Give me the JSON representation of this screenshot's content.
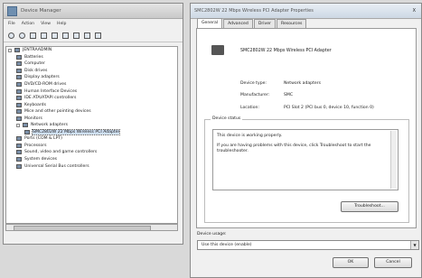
{
  "device_manager": {
    "title": "Device Manager",
    "menu": [
      "File",
      "Action",
      "View",
      "Help"
    ],
    "tree": [
      {
        "label": "JENTRAADMIN",
        "level": 0,
        "expander": true
      },
      {
        "label": "Batteries",
        "level": 1
      },
      {
        "label": "Computer",
        "level": 1
      },
      {
        "label": "Disk drives",
        "level": 1
      },
      {
        "label": "Display adapters",
        "level": 1
      },
      {
        "label": "DVD/CD-ROM drives",
        "level": 1
      },
      {
        "label": "Human Interface Devices",
        "level": 1
      },
      {
        "label": "IDE ATA/ATAPI controllers",
        "level": 1
      },
      {
        "label": "Keyboards",
        "level": 1
      },
      {
        "label": "Mice and other pointing devices",
        "level": 1
      },
      {
        "label": "Monitors",
        "level": 1
      },
      {
        "label": "Network adapters",
        "level": 1,
        "expander": true
      },
      {
        "label": "SMC2802W 22 Mbps Wireless PCI Adapter",
        "level": 2,
        "selected": true
      },
      {
        "label": "Ports (COM & LPT)",
        "level": 1
      },
      {
        "label": "Processors",
        "level": 1
      },
      {
        "label": "Sound, video and game controllers",
        "level": 1
      },
      {
        "label": "System devices",
        "level": 1
      },
      {
        "label": "Universal Serial Bus controllers",
        "level": 1
      }
    ]
  },
  "properties": {
    "title": "SMC2802W 22 Mbps Wireless PCI Adapter Properties",
    "close_label": "X",
    "tabs": [
      "General",
      "Advanced",
      "Driver",
      "Resources"
    ],
    "device_name": "SMC2802W 22 Mbps Wireless PCI Adapter",
    "rows": [
      {
        "label": "Device type:",
        "value": "Network adapters"
      },
      {
        "label": "Manufacturer:",
        "value": "SMC"
      },
      {
        "label": "Location:",
        "value": "PCI Slot 2 (PCI bus 0, device 10, function 0)"
      }
    ],
    "status_group_label": "Device status",
    "status_line1": "This device is working properly.",
    "status_line2": "If you are having problems with this device, click Troubleshoot to start the troubleshooter.",
    "troubleshoot_label": "Troubleshoot...",
    "usage_label": "Device usage:",
    "usage_value": "Use this device (enable)",
    "ok_label": "OK",
    "cancel_label": "Cancel"
  }
}
